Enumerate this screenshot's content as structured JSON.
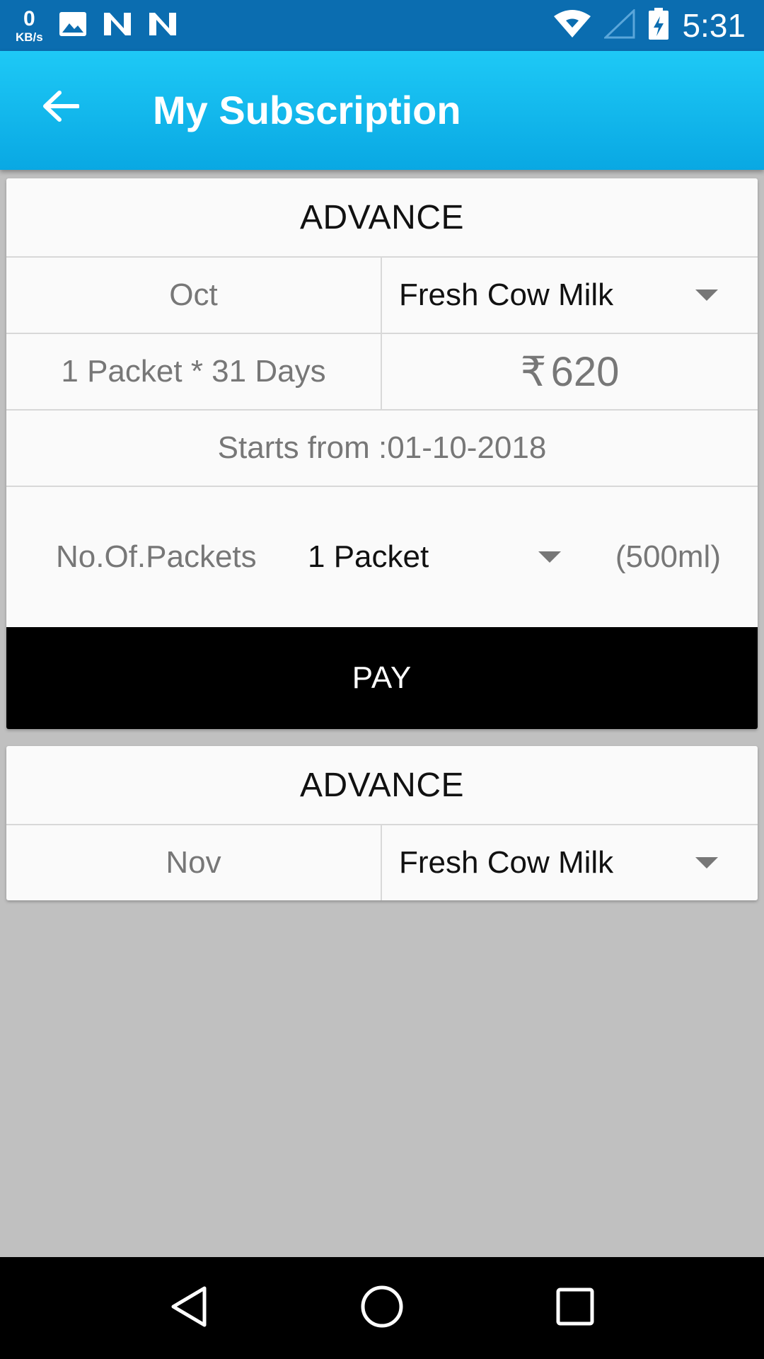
{
  "status_bar": {
    "net_speed": "0",
    "net_unit": "KB/s",
    "time": "5:31",
    "icons": [
      "image-icon",
      "n-notification-icon",
      "n-notification-icon",
      "wifi-icon",
      "signal-icon",
      "battery-charging-icon"
    ]
  },
  "app_bar": {
    "title": "My Subscription",
    "back_icon": "arrow-left-icon"
  },
  "cards": [
    {
      "header": "ADVANCE",
      "month": "Oct",
      "product": "Fresh Cow Milk",
      "quantity_days": "1 Packet * 31 Days",
      "currency_symbol": "₹",
      "price": "620",
      "start_text": "Starts from :01-10-2018",
      "packets_label": "No.Of.Packets",
      "packets_value": "1 Packet",
      "packet_size": "(500ml)",
      "pay_label": "PAY"
    },
    {
      "header": "ADVANCE",
      "month": "Nov",
      "product": "Fresh Cow Milk"
    }
  ],
  "colors": {
    "status_bar": "#0b6db0",
    "app_bar_top": "#1ec9f6",
    "app_bar_bottom": "#09a8e3",
    "background": "#c0c0c0",
    "pay_button": "#000000"
  }
}
